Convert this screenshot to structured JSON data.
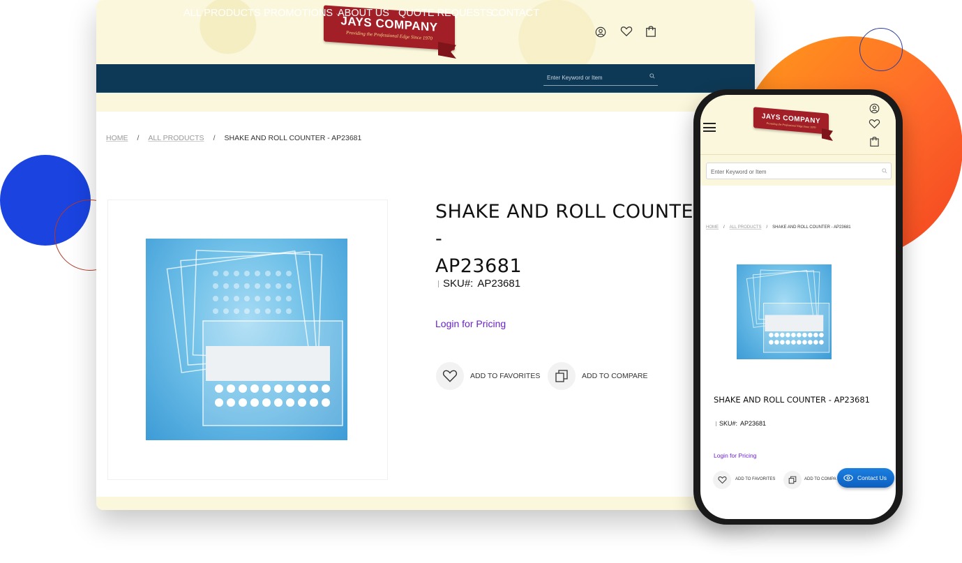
{
  "brand": {
    "logo_main": "JAYS COMPANY",
    "logo_tagline": "Providing the Professional Edge Since 1970",
    "logo_color": "#a31f27"
  },
  "header": {
    "icons": [
      "user-icon",
      "heart-icon",
      "shopping-bag-icon"
    ]
  },
  "nav": {
    "items": [
      {
        "label": "ALL PRODUCTS",
        "has_dropdown": true
      },
      {
        "label": "PROMOTIONS",
        "has_dropdown": true
      },
      {
        "label": "ABOUT US",
        "has_dropdown": false
      },
      {
        "label": "QUOTE REQUESTS",
        "has_dropdown": true
      },
      {
        "label": "CONTACT",
        "has_dropdown": false
      }
    ],
    "chevron": "⌵",
    "search_placeholder": "Enter Keyword or Item",
    "bg_color": "#0e3956"
  },
  "breadcrumb": {
    "home": "HOME",
    "separator": "/",
    "all_products": "ALL PRODUCTS",
    "current": "SHAKE AND ROLL COUNTER - AP23681"
  },
  "product": {
    "title_line1": "SHAKE AND ROLL COUNTER -",
    "title_line2": "AP23681",
    "title_full": "SHAKE AND ROLL COUNTER - AP23681",
    "sku_label": "SKU#:",
    "sku_value": "AP23681",
    "login_link": "Login for Pricing",
    "add_to_favorites": "ADD TO FAVORITES",
    "add_to_compare": "ADD TO COMPARE",
    "add_to_compare_truncated": "ADD TO COMPA",
    "link_color": "#6b1fd0"
  },
  "mobile": {
    "search_placeholder": "Enter Keyword or Item",
    "contact_button": "Contact Us",
    "contact_color": "#1b7fe0"
  }
}
